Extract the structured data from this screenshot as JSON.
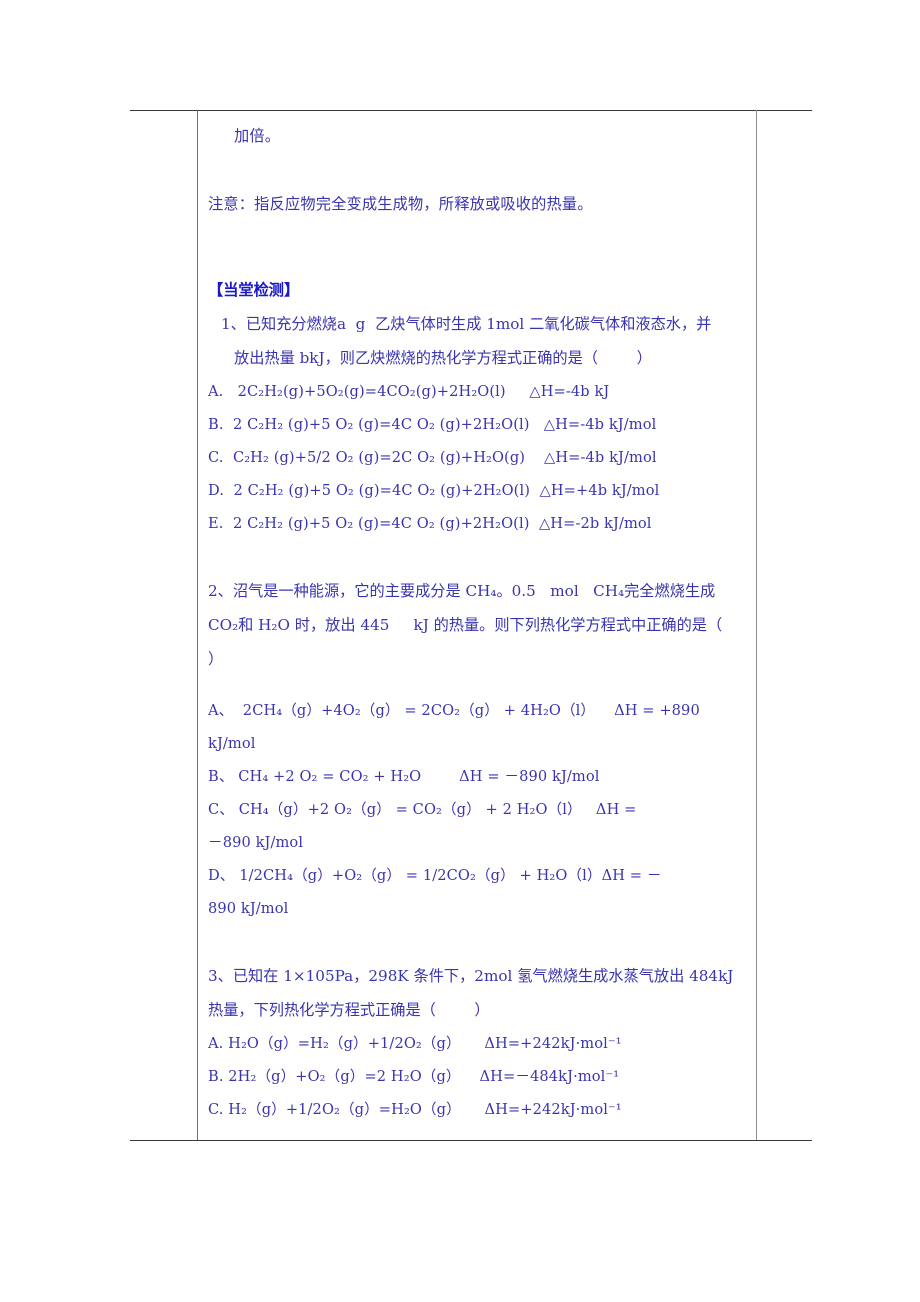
{
  "document": {
    "type": "chemistry-worksheet",
    "language": "zh-CN",
    "text_color": "#3a34ae",
    "heading_color": "#1a18c8",
    "border_color": "#3a3a3a"
  },
  "table": {
    "columns": [
      "left-narrow-empty",
      "main-content",
      "right-narrow-empty"
    ],
    "left_cell_text": "",
    "right_cell_text": ""
  },
  "content": {
    "continued_line": "加倍。",
    "note_line": "注意：指反应物完全变成生成物，所释放或吸收的热量。",
    "section_heading": "【当堂检测】",
    "questions": [
      {
        "number": "1",
        "stem_line_1": "1、已知充分燃烧a  g  乙炔气体时生成 1mol 二氧化碳气体和液态水，并",
        "stem_line_2": "放出热量 bkJ，则乙炔燃烧的热化学方程式正确的是（        ）",
        "options": [
          "A.   2C₂H₂(g)+5O₂(g)=4CO₂(g)+2H₂O(l)     △H=-4b kJ",
          "B.  2 C₂H₂ (g)+5 O₂ (g)=4C O₂ (g)+2H₂O(l)   △H=-4b kJ/mol",
          "C.  C₂H₂ (g)+5/2 O₂ (g)=2C O₂ (g)+H₂O(g)    △H=-4b kJ/mol",
          "D.  2 C₂H₂ (g)+5 O₂ (g)=4C O₂ (g)+2H₂O(l)  △H=+4b kJ/mol",
          "E.  2 C₂H₂ (g)+5 O₂ (g)=4C O₂ (g)+2H₂O(l)  △H=-2b kJ/mol"
        ]
      },
      {
        "number": "2",
        "stem_line_1": "2、沼气是一种能源，它的主要成分是 CH₄。0.5   mol   CH₄完全燃烧生成",
        "stem_line_2": "CO₂和 H₂O 时，放出 445     kJ 的热量。则下列热化学方程式中正确的是（",
        "stem_line_3": "）",
        "options": [
          "A、  2CH₄（g）+4O₂（g） = 2CO₂（g） + 4H₂O（l）    ΔH = +890",
          "kJ/mol",
          "B、 CH₄ +2 O₂ = CO₂ + H₂O        ΔH = －890 kJ/mol",
          "C、 CH₄（g）+2 O₂（g） = CO₂（g） + 2 H₂O（l）   ΔH =",
          "－890 kJ/mol",
          "D、 1/2CH₄（g）+O₂（g） = 1/2CO₂（g） + H₂O（l）ΔH = －",
          "890 kJ/mol"
        ]
      },
      {
        "number": "3",
        "stem_line_1": "3、已知在 1×105Pa，298K 条件下，2mol 氢气燃烧生成水蒸气放出 484kJ",
        "stem_line_2": "热量，下列热化学方程式正确是（        ）",
        "options": [
          "A. H₂O（g）=H₂（g）+1/2O₂（g）     ΔH=+242kJ·mol⁻¹",
          "B. 2H₂（g）+O₂（g）=2 H₂O（g）    ΔH=－484kJ·mol⁻¹",
          "C. H₂（g）+1/2O₂（g）=H₂O（g）     ΔH=+242kJ·mol⁻¹"
        ]
      }
    ]
  }
}
